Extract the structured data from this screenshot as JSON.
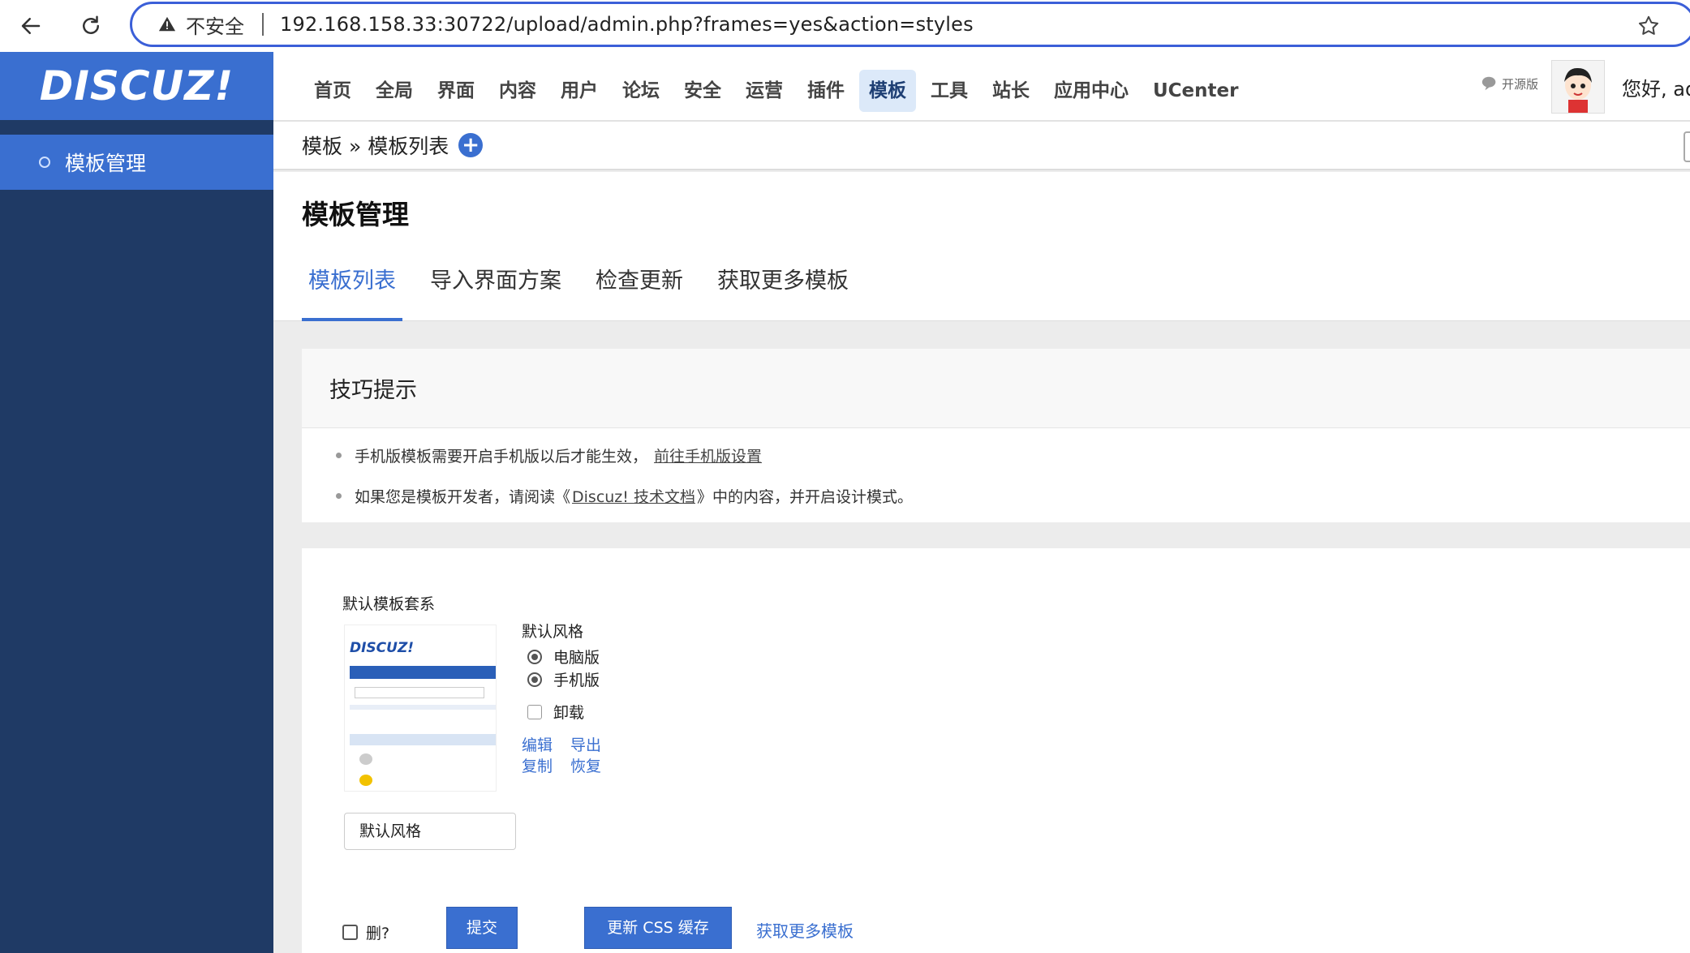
{
  "browser": {
    "security_label": "不安全",
    "url": "192.168.158.33:30722/upload/admin.php?frames=yes&action=styles"
  },
  "header": {
    "logo": "DISCUZ!",
    "nav_items": [
      "首页",
      "全局",
      "界面",
      "内容",
      "用户",
      "论坛",
      "安全",
      "运营",
      "插件",
      "模板",
      "工具",
      "站长",
      "应用中心",
      "UCenter"
    ],
    "active_nav": "模板",
    "edition_label": "开源版",
    "greeting": "您好, ad"
  },
  "sidebar": {
    "items": [
      {
        "label": "模板管理",
        "active": true
      }
    ]
  },
  "breadcrumb": "模板 » 模板列表",
  "page": {
    "title": "模板管理",
    "tabs": [
      "模板列表",
      "导入界面方案",
      "检查更新",
      "获取更多模板"
    ],
    "active_tab": "模板列表"
  },
  "tips": {
    "title": "技巧提示",
    "line1_text": "手机版模板需要开启手机版以后才能生效，",
    "line1_link": "前往手机版设置",
    "line2_prefix": "如果您是模板开发者，请阅读《",
    "line2_link": "Discuz! 技术文档",
    "line2_suffix": "》中的内容，并开启设计模式。"
  },
  "theme": {
    "set_title": "默认模板套系",
    "thumb_logo": "DISCUZ!",
    "style_label": "默认风格",
    "options": [
      {
        "label": "电脑版",
        "checked": true
      },
      {
        "label": "手机版",
        "checked": true
      }
    ],
    "uninstall_label": "卸载",
    "actions": {
      "edit": "编辑",
      "export": "导出",
      "copy": "复制",
      "restore": "恢复"
    },
    "style_name_value": "默认风格"
  },
  "footer": {
    "delete_label": "删?",
    "submit_label": "提交",
    "update_css_label": "更新 CSS 缓存",
    "more_templates_label": "获取更多模板"
  },
  "colors": {
    "accent": "#3a6fd0",
    "sidebar_bg": "#1f3a65",
    "active_nav_bg": "#dce9f9"
  }
}
